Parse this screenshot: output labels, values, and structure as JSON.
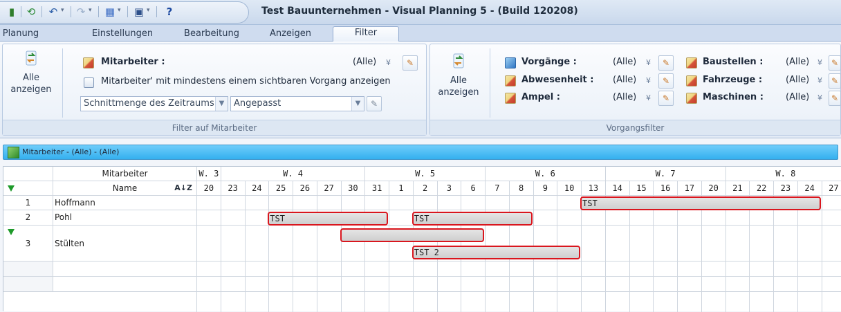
{
  "window": {
    "title": "Test Bauunternehmen - Visual Planning 5 - (Build 120208)",
    "qat_icons": [
      "app-icon",
      "refresh-icon",
      "undo-icon",
      "redo-icon",
      "planning-icon",
      "view-icon",
      "help-icon"
    ],
    "help_glyph": "?"
  },
  "ribbon": {
    "tabs": [
      {
        "label": "Planung"
      },
      {
        "label": "Einstellungen"
      },
      {
        "label": "Bearbeitung"
      },
      {
        "label": "Anzeigen"
      },
      {
        "label": "Filter"
      }
    ],
    "active_tab": "Filter",
    "employee_group": {
      "show_all_label_1": "Alle",
      "show_all_label_2": "anzeigen",
      "mitarbeiter_label": "Mitarbeiter :",
      "mitarbeiter_value": "(Alle)",
      "checkbox_label": "Mitarbeiter' mit mindestens einem sichtbaren Vorgang anzeigen",
      "checkbox_checked": false,
      "combo1_value": "Schnittmenge des Zeitraums",
      "combo2_value": "Angepasst",
      "group_label": "Filter auf Mitarbeiter"
    },
    "task_group": {
      "show_all_label_1": "Alle",
      "show_all_label_2": "anzeigen",
      "filters": [
        {
          "label": "Vorgänge :",
          "value": "(Alle)"
        },
        {
          "label": "Abwesenheit :",
          "value": "(Alle)"
        },
        {
          "label": "Ampel :",
          "value": "(Alle)"
        },
        {
          "label": "Baustellen :",
          "value": "(Alle)"
        },
        {
          "label": "Fahrzeuge :",
          "value": "(Alle)"
        },
        {
          "label": "Maschinen :",
          "value": "(Alle)"
        }
      ],
      "group_label": "Vorgangsfilter"
    }
  },
  "section": {
    "title": "Mitarbeiter - (Alle) - (Alle)"
  },
  "grid": {
    "header_mitarbeiter": "Mitarbeiter",
    "header_name": "Name",
    "sort_glyph": "A↓Z",
    "weeks": [
      "W. 3",
      "W. 4",
      "W. 5",
      "W. 6",
      "W. 7",
      "W. 8"
    ],
    "days": [
      "20",
      "23",
      "24",
      "25",
      "26",
      "27",
      "30",
      "31",
      "1",
      "2",
      "3",
      "6",
      "7",
      "8",
      "9",
      "10",
      "13",
      "14",
      "15",
      "16",
      "17",
      "20",
      "21",
      "22",
      "23",
      "24",
      "27"
    ],
    "rows": [
      {
        "num": "1",
        "name": "Hoffmann"
      },
      {
        "num": "2",
        "name": "Pohl"
      },
      {
        "num": "3",
        "name": "Stülten"
      }
    ],
    "bars": [
      {
        "label": "TST"
      },
      {
        "label": "TST"
      },
      {
        "label": "TST"
      },
      {
        "label": ""
      },
      {
        "label": "TST 2"
      }
    ]
  },
  "colors": {
    "accent_bar_border": "#d9161e",
    "section_bar": "#34b0ef",
    "filter_arrow": "#1e9a2a"
  }
}
